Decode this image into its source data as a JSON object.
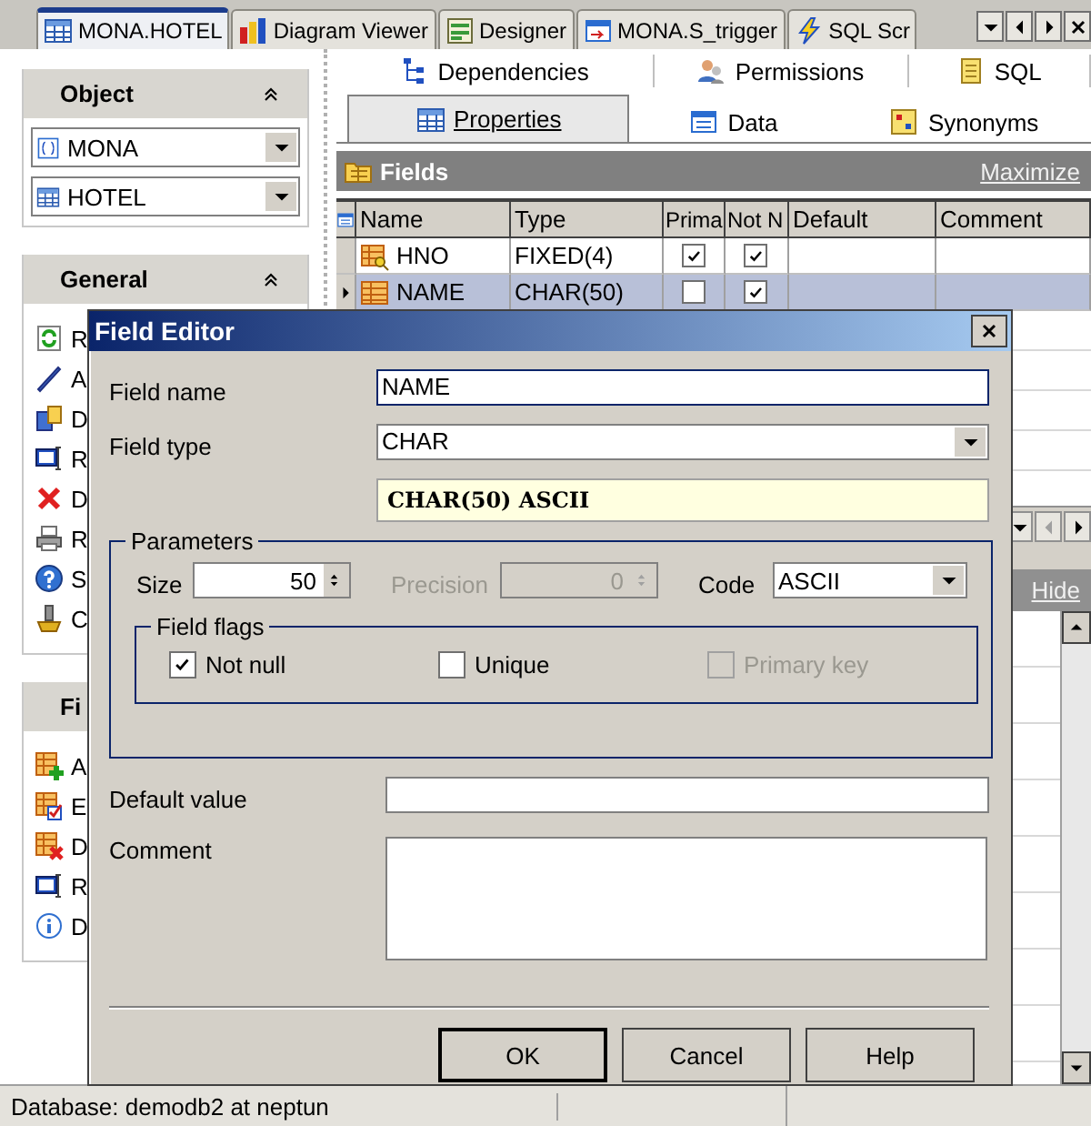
{
  "document_tabs": [
    {
      "label": "MONA.HOTEL",
      "selected": true
    },
    {
      "label": "Diagram Viewer",
      "selected": false
    },
    {
      "label": "Designer",
      "selected": false
    },
    {
      "label": "MONA.S_trigger",
      "selected": false
    },
    {
      "label": "SQL Scr",
      "selected": false
    }
  ],
  "object_panel": {
    "title": "Object",
    "schema": "MONA",
    "table": "HOTEL"
  },
  "general_panel": {
    "title": "General",
    "items": [
      "R",
      "A",
      "D",
      "R",
      "D",
      "R",
      "S",
      "C"
    ]
  },
  "fields_panel": {
    "title": "Fi",
    "items": [
      "A",
      "E",
      "D",
      "R",
      "D"
    ]
  },
  "upper_tabs": [
    {
      "label": "Dependencies",
      "selected": false
    },
    {
      "label": "Permissions",
      "selected": false
    },
    {
      "label": "SQL",
      "selected": false
    }
  ],
  "lower_tabs": [
    {
      "label": "Properties",
      "selected": true
    },
    {
      "label": "Data",
      "selected": false
    },
    {
      "label": "Synonyms",
      "selected": false
    }
  ],
  "fields_grid": {
    "title": "Fields",
    "maximize": "Maximize",
    "columns": [
      "Name",
      "Type",
      "Prima",
      "Not N",
      "Default",
      "Comment"
    ],
    "rows": [
      {
        "name": "HNO",
        "kind": "key",
        "type": "FIXED(4)",
        "primary": true,
        "not_null": true,
        "selected": false
      },
      {
        "name": "NAME",
        "kind": "field",
        "type": "CHAR(50)",
        "primary": false,
        "not_null": true,
        "selected": true
      }
    ]
  },
  "detail_pane": {
    "hide": "Hide"
  },
  "dialog": {
    "title": "Field Editor",
    "field_name_label": "Field name",
    "field_name": "NAME",
    "field_type_label": "Field type",
    "field_type": "CHAR",
    "type_summary": "CHAR(50) ASCII",
    "parameters": {
      "title": "Parameters",
      "size_label": "Size",
      "size": "50",
      "precision_label": "Precision",
      "precision": "0",
      "precision_disabled": true,
      "code_label": "Code",
      "code": "ASCII"
    },
    "flags": {
      "title": "Field flags",
      "items": [
        {
          "label": "Not null",
          "checked": true,
          "disabled": false
        },
        {
          "label": "Unique",
          "checked": false,
          "disabled": false
        },
        {
          "label": "Primary key",
          "checked": false,
          "disabled": true
        }
      ]
    },
    "default_label": "Default value",
    "comment_label": "Comment",
    "buttons": [
      {
        "label": "OK",
        "default": true
      },
      {
        "label": "Cancel",
        "default": false
      },
      {
        "label": "Help",
        "default": false
      }
    ]
  },
  "status_bar": "Database: demodb2 at neptun"
}
